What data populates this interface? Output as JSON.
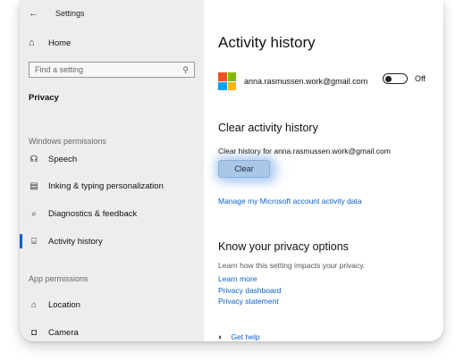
{
  "colors": {
    "accent": "#0b61c4",
    "sidebar_bg": "#ededed",
    "button_bg": "#aac7e8"
  },
  "titlebar": {
    "back_icon": "arrow-left-icon",
    "title": "Settings"
  },
  "sidebar": {
    "home_label": "Home",
    "search_placeholder": "Find a setting",
    "category": "Privacy",
    "windows_permissions": "Windows permissions",
    "items": [
      {
        "icon": "speech-icon",
        "label": "Speech"
      },
      {
        "icon": "inking-icon",
        "label": "Inking & typing personalization"
      },
      {
        "icon": "diagnostics-icon",
        "label": "Diagnostics & feedback"
      },
      {
        "icon": "activity-history-icon",
        "label": "Activity history"
      }
    ],
    "app_permissions": "App permissions",
    "app_items": [
      {
        "icon": "location-icon",
        "label": "Location"
      },
      {
        "icon": "camera-icon",
        "label": "Camera"
      }
    ]
  },
  "main": {
    "title": "Activity history",
    "account_email": "anna.rasmussen.work@gmail.com",
    "toggle_state": "Off",
    "clear_heading": "Clear activity history",
    "clear_desc": "Clear history for anna.rasmussen.work@gmail.com",
    "clear_button": "Clear",
    "manage_link": "Manage my Microsoft account activity data",
    "privacy_heading": "Know your privacy options",
    "privacy_desc": "Learn how this setting impacts your privacy.",
    "links": [
      "Learn more",
      "Privacy dashboard",
      "Privacy statement"
    ],
    "get_help": "Get help"
  }
}
